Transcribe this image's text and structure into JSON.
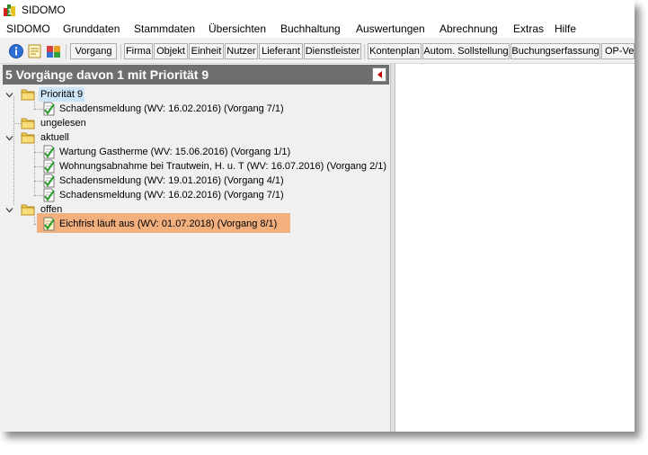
{
  "window": {
    "title": "SIDOMO"
  },
  "menu": [
    {
      "label": "SIDOMO"
    },
    {
      "label": "Grunddaten"
    },
    {
      "label": "Stammdaten"
    },
    {
      "label": "Übersichten"
    },
    {
      "label": "Buchhaltung"
    },
    {
      "label": "Auswertungen"
    },
    {
      "label": "Abrechnung"
    },
    {
      "label": "Extras"
    },
    {
      "label": "Hilfe"
    }
  ],
  "toolbar": {
    "icons": [
      "info-icon",
      "note-icon",
      "people-icon"
    ],
    "buttons": [
      {
        "label": "Vorgang"
      },
      {
        "label": "Firma"
      },
      {
        "label": "Objekt"
      },
      {
        "label": "Einheit"
      },
      {
        "label": "Nutzer"
      },
      {
        "label": "Lieferant"
      },
      {
        "label": "Dienstleister"
      },
      {
        "label": "Kontenplan"
      },
      {
        "label": "Autom. Sollstellung"
      },
      {
        "label": "Buchungserfassung"
      },
      {
        "label": "OP-Ve"
      }
    ]
  },
  "panel": {
    "title": "5 Vorgänge davon 1 mit Priorität 9"
  },
  "tree": [
    {
      "label": "Priorität 9",
      "children": [
        {
          "label": "Schadensmeldung (WV: 16.02.2016) (Vorgang 7/1)"
        }
      ]
    },
    {
      "label": "ungelesen",
      "children": []
    },
    {
      "label": "aktuell",
      "children": [
        {
          "label": "Wartung Gastherme (WV: 15.06.2016) (Vorgang 1/1)"
        },
        {
          "label": "Wohnungsabnahme bei Trautwein, H. u. T (WV: 16.07.2016) (Vorgang 2/1)"
        },
        {
          "label": "Schadensmeldung (WV: 19.01.2016) (Vorgang 4/1)"
        },
        {
          "label": "Schadensmeldung (WV: 16.02.2016) (Vorgang 7/1)"
        }
      ]
    },
    {
      "label": "offen",
      "children": [
        {
          "label": "Eichfrist läuft aus (WV: 01.07.2018) (Vorgang 8/1)"
        }
      ]
    }
  ],
  "colors": {
    "header_bg": "#6e6e6e",
    "highlight": "#f2b07e",
    "selection": "#cce4f7",
    "panel_bg": "#f0f0f0"
  }
}
